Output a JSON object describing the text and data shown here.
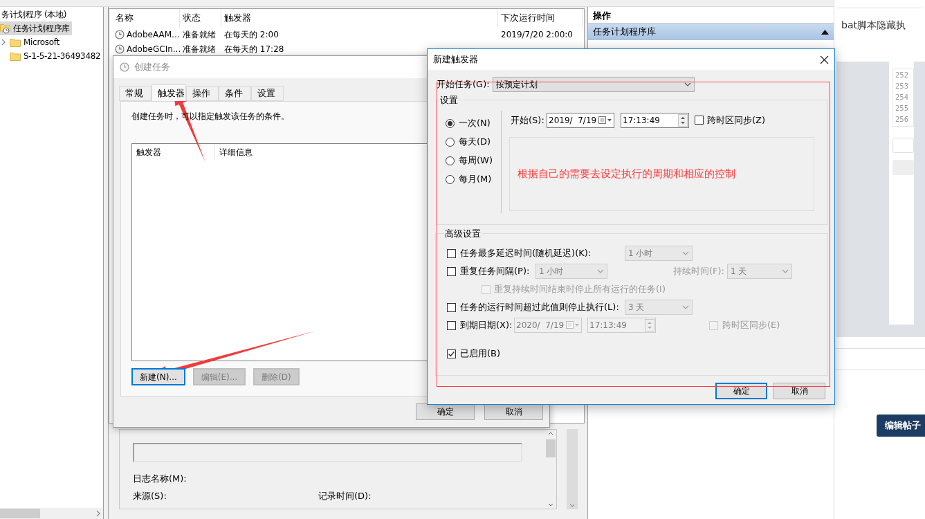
{
  "scheduler": {
    "tree": {
      "items": [
        {
          "label": "务计划程序 (本地)",
          "selected": false,
          "children": [
            {
              "label": "任务计划程序库",
              "kind": "library",
              "selected": true,
              "children": [
                {
                  "label": "Microsoft",
                  "kind": "folder",
                  "selected": false,
                  "expandable": true
                },
                {
                  "label": "S-1-5-21-36493482",
                  "kind": "folder",
                  "selected": false,
                  "expandable": false
                }
              ]
            }
          ]
        }
      ]
    },
    "task_list": {
      "columns": [
        "名称",
        "状态",
        "触发器",
        "下次运行时间"
      ],
      "rows": [
        {
          "cells": [
            "AdobeAAM...",
            "准备就绪",
            "在每天的 2:00",
            "2019/7/20 2:00:0"
          ]
        },
        {
          "cells": [
            "AdobeGCIn...",
            "准备就绪",
            "在每天的 17:28"
          ]
        }
      ]
    },
    "details": {
      "log_name": "日志名称(M):",
      "source": "来源(S):",
      "logged": "记录时间(D):"
    },
    "actions_pane": {
      "title": "操作",
      "section": {
        "label": "任务计划程序库",
        "expanded": true
      }
    }
  },
  "create_task_dialog": {
    "title": "创建任务",
    "tabs": [
      {
        "label": "常规",
        "selected": false
      },
      {
        "label": "触发器",
        "selected": true
      },
      {
        "label": "操作",
        "selected": false
      },
      {
        "label": "条件",
        "selected": false
      },
      {
        "label": "设置",
        "selected": false
      }
    ],
    "description": "创建任务时，可以指定触发该任务的条件。",
    "list_columns": [
      "触发器",
      "详细信息"
    ],
    "actions": [
      {
        "label": "新建(N)...",
        "disabled": false,
        "focused": true
      },
      {
        "label": "编辑(E)...",
        "disabled": true,
        "focused": false
      },
      {
        "label": "删除(D)",
        "disabled": true,
        "focused": false
      }
    ],
    "buttons": [
      {
        "label": "确定"
      },
      {
        "label": "取消"
      }
    ]
  },
  "trigger_dialog": {
    "title": "新建触发器",
    "begin_label": "开始任务(G):",
    "begin_value": "按预定计划",
    "settings": {
      "legend": "设置",
      "schedules": [
        {
          "label": "一次(N)",
          "selected": true
        },
        {
          "label": "每天(D)",
          "selected": false
        },
        {
          "label": "每周(W)",
          "selected": false
        },
        {
          "label": "每月(M)",
          "selected": false
        }
      ],
      "start_label": "开始(S):",
      "start_date": "2019/  7/19",
      "start_time": "17:13:49",
      "sync": {
        "label": "跨时区同步(Z)",
        "checked": false
      },
      "note": "根据自己的需要去设定执行的周期和相应的控制"
    },
    "advanced": {
      "legend": "高级设置",
      "rows": [
        {
          "kind": "select",
          "label": "任务最多延迟时间(随机延迟)(K):",
          "checked": false,
          "value": "1 小时"
        },
        {
          "kind": "repeat",
          "label": "重复任务间隔(P):",
          "checked": false,
          "value": "1 小时",
          "duration_label": "持续时间(F):",
          "duration_value": "1 天"
        },
        {
          "kind": "sub",
          "label": "重复持续时间结束时停止所有运行的任务(I)",
          "checked": false
        },
        {
          "kind": "select",
          "label": "任务的运行时间超过此值则停止执行(L):",
          "checked": false,
          "value": "3 天"
        },
        {
          "kind": "expiry",
          "label": "到期日期(X):",
          "checked": false,
          "date": "2020/  7/19",
          "time": "17:13:49",
          "sync_label": "跨时区同步(E)",
          "sync_checked": false
        },
        {
          "kind": "plain",
          "label": "已启用(B)",
          "checked": true
        }
      ]
    },
    "buttons": [
      {
        "label": "确定",
        "focused": true
      },
      {
        "label": "取消",
        "focused": false
      }
    ]
  },
  "browser_page": {
    "heading_fragment": "bat脚本隐藏执",
    "line_numbers": [
      "252",
      "253",
      "254",
      "255",
      "256"
    ],
    "edit_button": "编辑帖子"
  }
}
